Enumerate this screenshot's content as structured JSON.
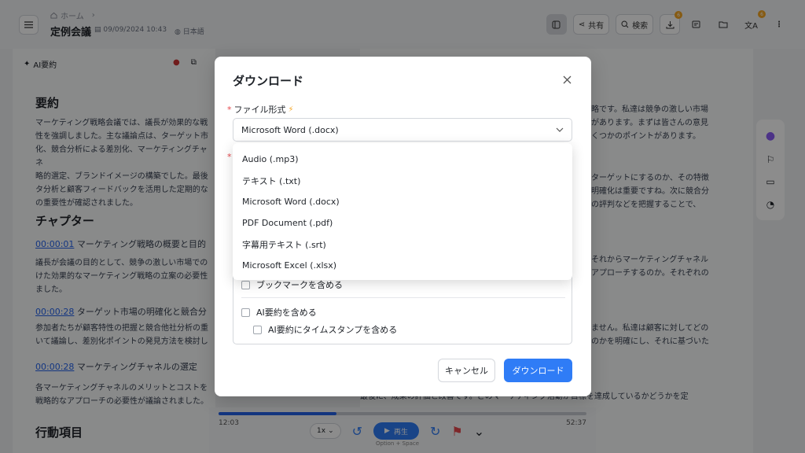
{
  "header": {
    "breadcrumb_home": "ホーム",
    "title": "定例会議",
    "date": "09/09/2024 10:43",
    "language": "日本語",
    "share_label": "共有",
    "search_label": "検索",
    "badge_download": "6",
    "badge_translate": "6"
  },
  "left_panel": {
    "ai_summary_label": "AI要約",
    "summary_heading": "要約",
    "summary_lines": [
      "マーケティング戦略会議では、議長が効果的な戦",
      "性を強調しました。主な議論点は、ターゲット市",
      "化、競合分析による差別化、マーケティングチャネ",
      "略的選定、ブランドイメージの構築でした。最後",
      "タ分析と顧客フィードバックを活用した定期的な",
      "の重要性が確認されました。"
    ],
    "chapter_heading": "チャプター",
    "chapters": [
      {
        "time": "00:00:01",
        "title": "マーケティング戦略の概要と目的",
        "lines": [
          "議長が会議の目的として、競争の激しい市場での",
          "けた効果的なマーケティング戦略の立案の必要性",
          "ました。"
        ]
      },
      {
        "time": "00:00:28",
        "title": "ターゲット市場の明確化と競合分",
        "lines": [
          "参加者たちが顧客特性の把握と競合他社分析の重",
          "いて議論し、差別化ポイントの発見方法を検討し"
        ]
      },
      {
        "time": "00:00:28",
        "title": "マーケティングチャネルの選定",
        "lines": [
          "各マーケティングチャネルのメリットとコストを",
          "戦略的なアプローチの必要性が議論されました。"
        ]
      }
    ],
    "action_heading": "行動項目"
  },
  "right_panel": {
    "lines": [
      "略です。私達は競争の激しい市場",
      "があります。まずは皆さんの意見",
      "くつかのポイントがあります。",
      "ターゲットにするのか、その特徴",
      "明確化は重要ですね。次に競合分",
      "の評判などを把握することで、",
      "それからマーケティングチャネル",
      "アプローチするのか。それぞれの",
      "ません。私達は顧客に対してどの",
      "のかを明確にし、それに基づいた",
      "最後に、成果の評価と改善です。どのマーケティング活動が目標を達成しているかどうかを定"
    ]
  },
  "player": {
    "current_time": "12:03",
    "total_time": "52:37",
    "speed": "1x",
    "play_label": "再生",
    "play_hint": "Option + Space",
    "progress": 0.32
  },
  "modal": {
    "title": "ダウンロード",
    "format_label": "ファイル形式",
    "selected_format": "Microsoft Word (.docx)",
    "format_options": [
      "Audio (.mp3)",
      "テキスト (.txt)",
      "Microsoft Word (.docx)",
      "PDF Document (.pdf)",
      "字幕用テキスト (.srt)",
      "Microsoft Excel (.xlsx)"
    ],
    "include_bookmarks": "ブックマークを含める",
    "include_ai_summary": "AI要約を含める",
    "include_ai_timestamps": "AI要約にタイムスタンプを含める",
    "cancel_label": "キャンセル",
    "download_label": "ダウンロード"
  },
  "colors": {
    "accent": "#2f7cf6",
    "required": "#e5484d",
    "badge": "#f5a623"
  }
}
